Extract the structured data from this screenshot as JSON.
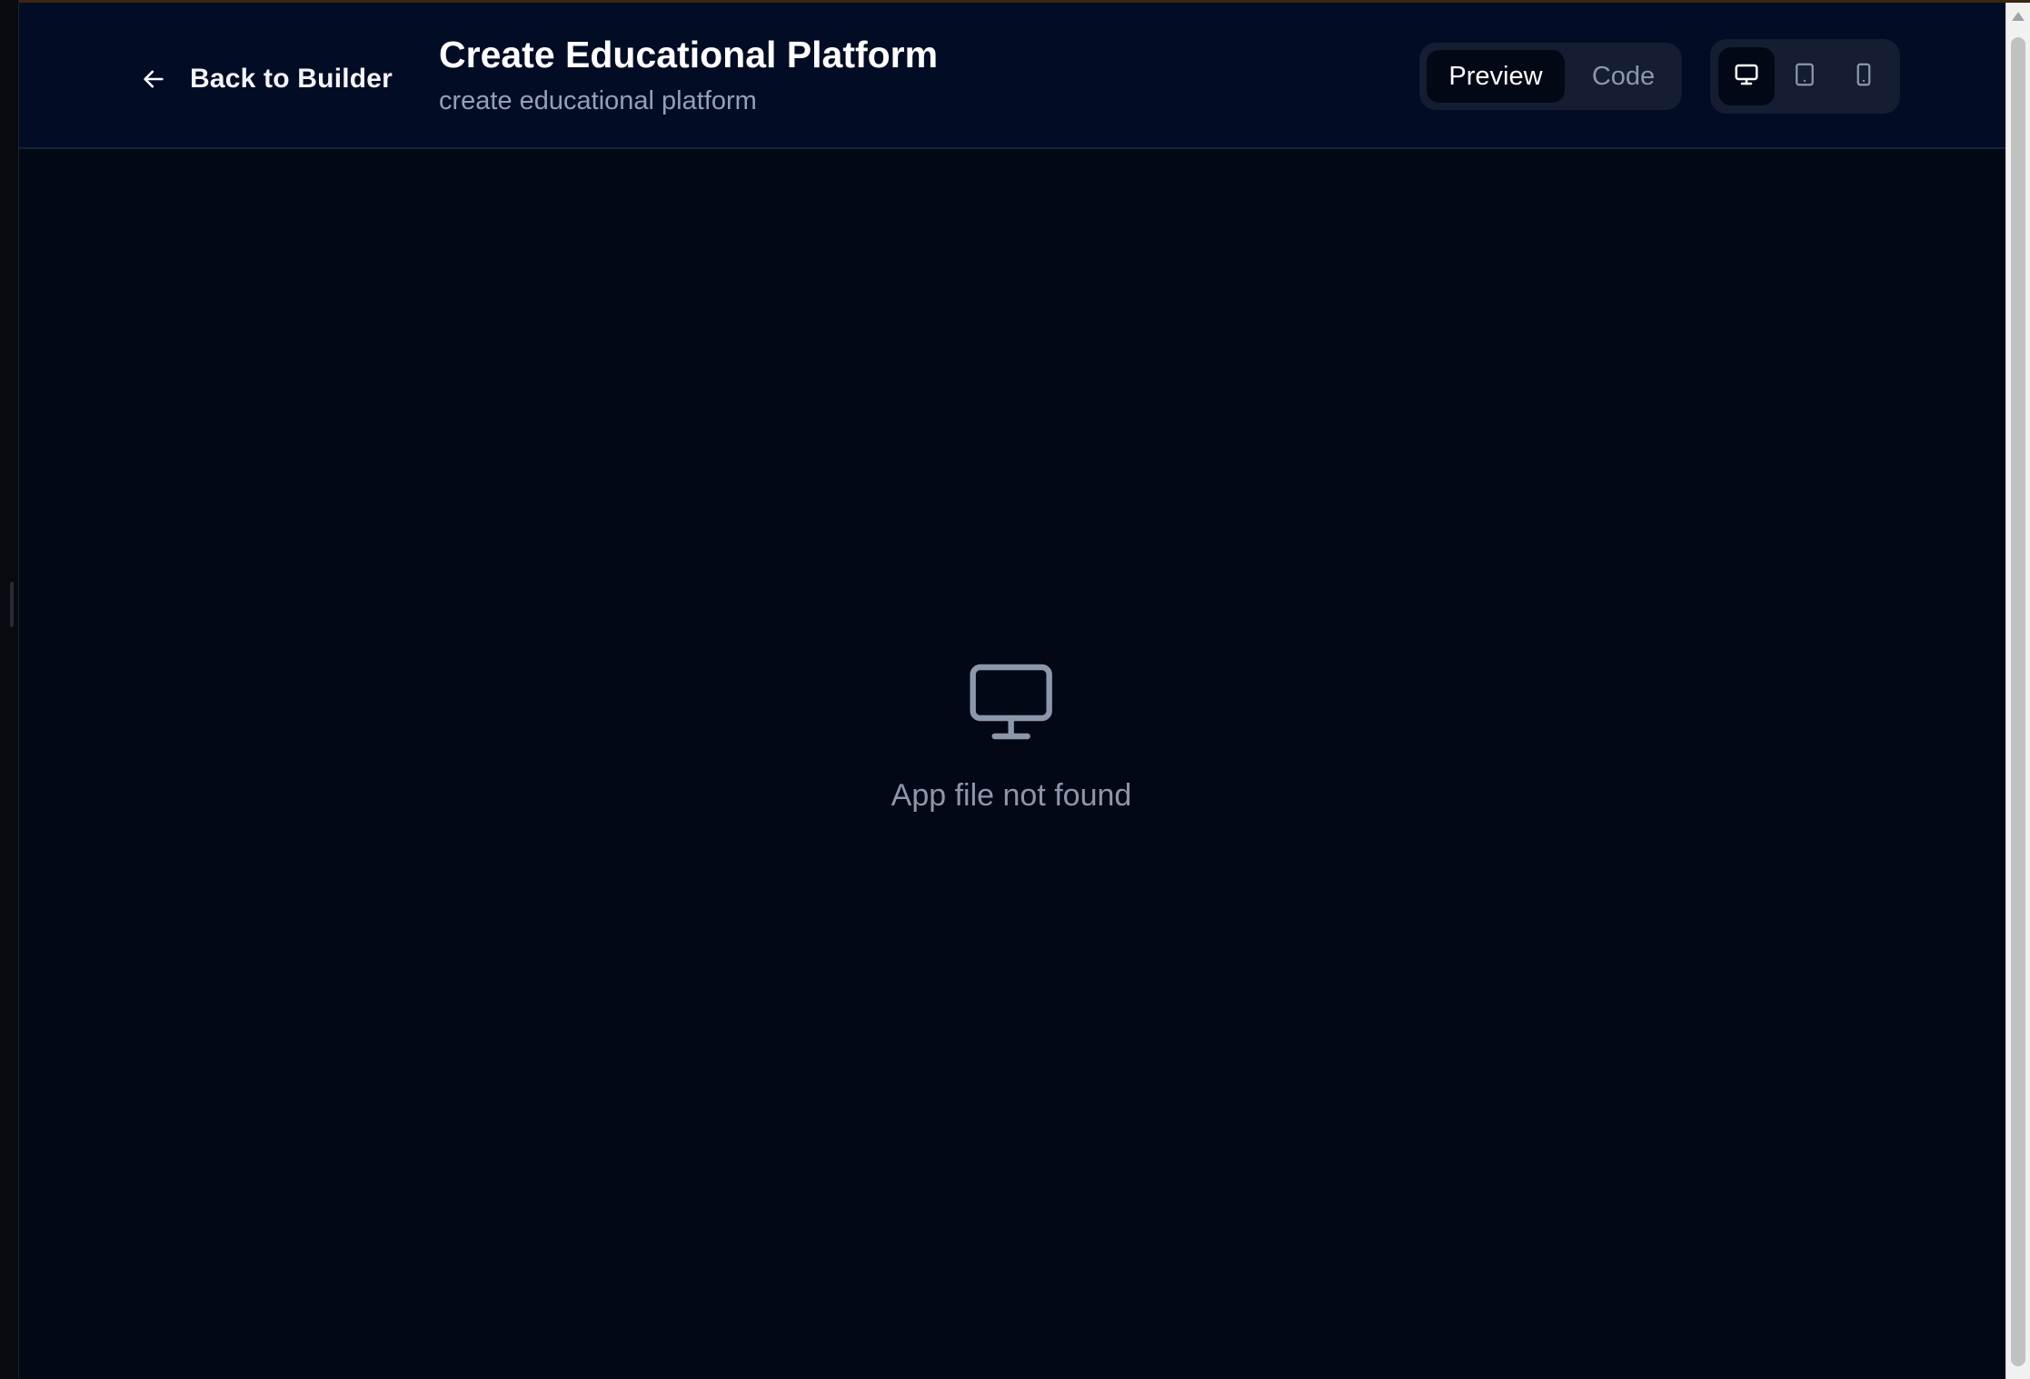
{
  "header": {
    "back_label": "Back to Builder",
    "title": "Create Educational Platform",
    "subtitle": "create educational platform"
  },
  "view_toggle": {
    "selected": "Preview",
    "options": [
      "Preview",
      "Code"
    ]
  },
  "device_toggle": {
    "selected": "desktop",
    "options": [
      "desktop",
      "tablet",
      "mobile"
    ]
  },
  "empty_state": {
    "icon": "monitor-icon",
    "message": "App file not found"
  },
  "colors": {
    "header_bg": "#020c24",
    "content_bg": "#020816",
    "muted_text": "#8d97aa",
    "toggle_bg": "#141d31"
  }
}
